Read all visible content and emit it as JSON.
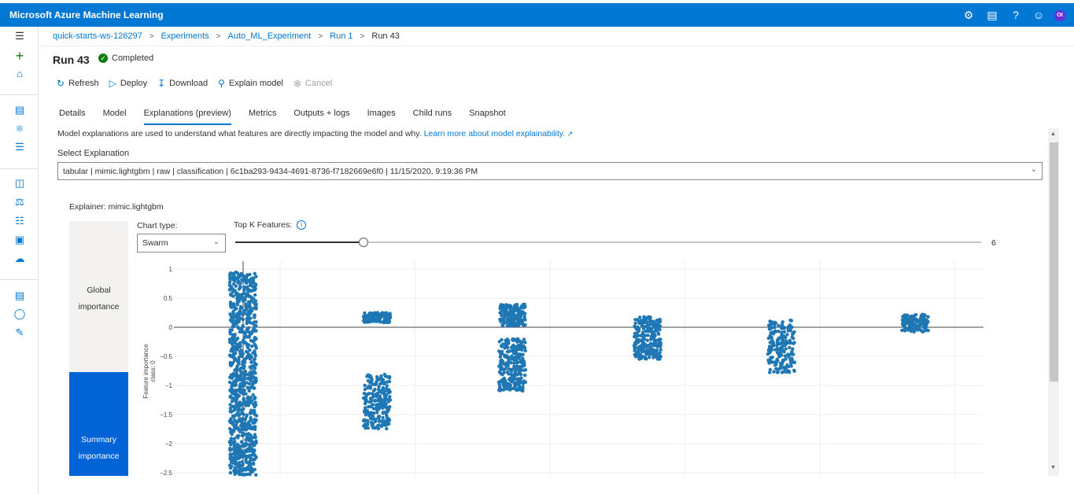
{
  "topbar": {
    "title": "Microsoft Azure Machine Learning",
    "icons": [
      "gear-icon",
      "feedback-icon",
      "help-icon",
      "smiley-icon"
    ],
    "avatar_initials": "OI",
    "color": "#0078d4"
  },
  "leftnav": {
    "icons": [
      "hamburger-icon",
      "plus-icon",
      "home-icon",
      "notebook-icon",
      "automl-icon",
      "designer-icon",
      "datasets-icon",
      "experiments-icon",
      "pipelines-icon",
      "models-icon",
      "endpoints-icon",
      "compute-icon",
      "datastores-icon",
      "labeling-icon"
    ]
  },
  "breadcrumb": {
    "items": [
      "quick-starts-ws-126297",
      "Experiments",
      "Auto_ML_Experiment",
      "Run 1"
    ],
    "current": "Run 43",
    "separator": ">"
  },
  "run": {
    "title": "Run 43",
    "status": "Completed",
    "status_color": "#107c10"
  },
  "toolbar": {
    "refresh": "Refresh",
    "deploy": "Deploy",
    "download": "Download",
    "explain_model": "Explain model",
    "cancel": "Cancel"
  },
  "tabs": [
    "Details",
    "Model",
    "Explanations (preview)",
    "Metrics",
    "Outputs + logs",
    "Images",
    "Child runs",
    "Snapshot"
  ],
  "active_tab": "Explanations (preview)",
  "explanations": {
    "description": "Model explanations are used to understand what features are directly impacting the model and why.",
    "learn_more": "Learn more about model explainability.",
    "select_label": "Select Explanation",
    "selected": "tabular | mimic.lightgbm | raw | classification | 6c1ba293-9434-4691-8736-f7182669e6f0 | 11/15/2020, 9:19:36 PM",
    "explainer_label": "Explainer:",
    "explainer_value": "mimic.lightgbm",
    "global_importance": "Global importance",
    "summary_importance": "Summary importance",
    "chart_type_label": "Chart type:",
    "chart_type_value": "Swarm",
    "top_k_label": "Top K Features:",
    "top_k_value": "6",
    "top_k_max": 10
  },
  "chart_data": {
    "type": "scatter",
    "ylabel_line1": "Feature importance",
    "ylabel_line2": "class:  0",
    "ylim": [
      -2.5,
      1
    ],
    "yticks": [
      "1",
      "0.5",
      "0",
      "−0.5",
      "−1",
      "−1.5",
      "−2",
      "−2.5"
    ],
    "ytick_values": [
      1,
      0.5,
      0,
      -0.5,
      -1,
      -1.5,
      -2,
      -2.5
    ],
    "grid": true,
    "color": "#1f77b4",
    "features": [
      {
        "index": 0,
        "clusters": [
          {
            "min": -2.55,
            "max": 0.95,
            "density": 900
          }
        ]
      },
      {
        "index": 1,
        "clusters": [
          {
            "min": 0.08,
            "max": 0.25,
            "density": 120
          },
          {
            "min": -1.75,
            "max": -0.8,
            "density": 230
          }
        ]
      },
      {
        "index": 2,
        "clusters": [
          {
            "min": 0.02,
            "max": 0.4,
            "density": 160
          },
          {
            "min": -1.1,
            "max": -0.2,
            "density": 260
          }
        ]
      },
      {
        "index": 3,
        "clusters": [
          {
            "min": -0.55,
            "max": 0.18,
            "density": 220
          }
        ]
      },
      {
        "index": 4,
        "clusters": [
          {
            "min": -0.78,
            "max": 0.12,
            "density": 190
          }
        ]
      },
      {
        "index": 5,
        "clusters": [
          {
            "min": -0.08,
            "max": 0.22,
            "density": 130
          }
        ]
      }
    ]
  }
}
